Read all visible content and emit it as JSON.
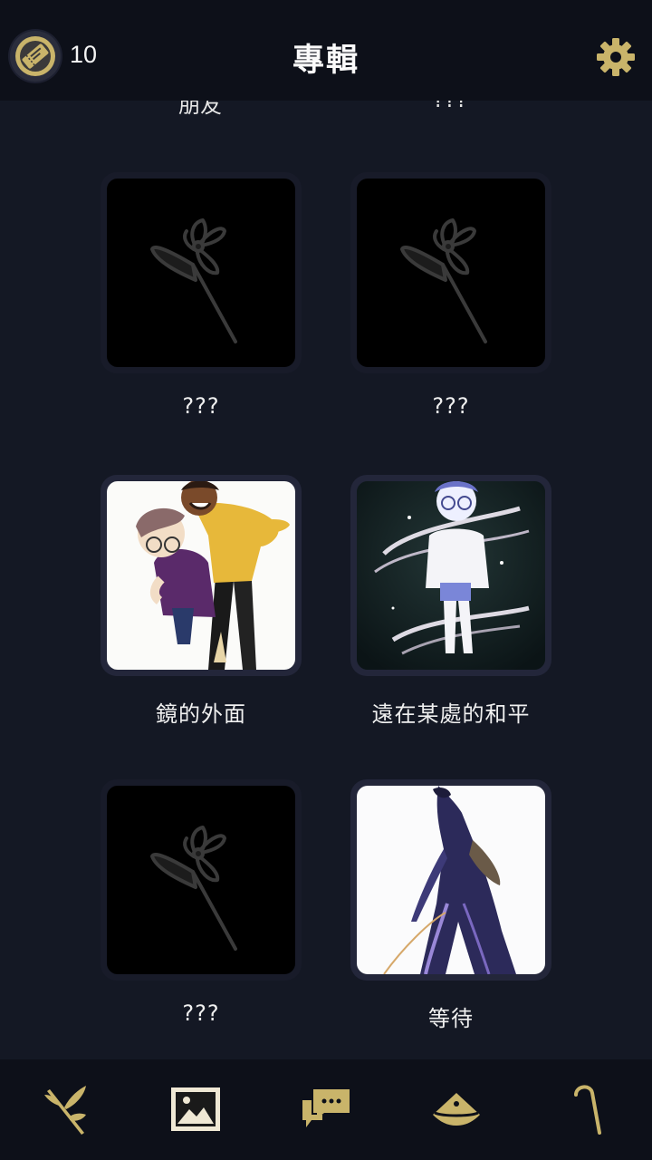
{
  "header": {
    "ticket_count": "10",
    "title": "專輯",
    "ticket_icon": "ticket-icon",
    "settings_icon": "gear-icon"
  },
  "prev_row": {
    "left_label": "朋友",
    "right_label": "???"
  },
  "albums": [
    {
      "label": "???",
      "locked": true,
      "icon": "flower-silhouette-icon"
    },
    {
      "label": "???",
      "locked": true,
      "icon": "flower-silhouette-icon"
    },
    {
      "label": "鏡的外面",
      "locked": false,
      "icon": "illustration-friends"
    },
    {
      "label": "遠在某處的和平",
      "locked": false,
      "icon": "illustration-glowing-boy"
    },
    {
      "label": "???",
      "locked": true,
      "icon": "flower-silhouette-icon"
    },
    {
      "label": "等待",
      "locked": false,
      "icon": "illustration-tall-figure"
    }
  ],
  "nav": [
    {
      "name": "home",
      "icon": "sprout-icon",
      "active": false
    },
    {
      "name": "album",
      "icon": "picture-icon",
      "active": true
    },
    {
      "name": "messages",
      "icon": "chat-icon",
      "active": false
    },
    {
      "name": "map",
      "icon": "hat-icon",
      "active": false
    },
    {
      "name": "cane",
      "icon": "cane-icon",
      "active": false
    }
  ],
  "colors": {
    "accent_gold": "#c9b46a",
    "background": "#141824",
    "bar": "#0d1019"
  }
}
